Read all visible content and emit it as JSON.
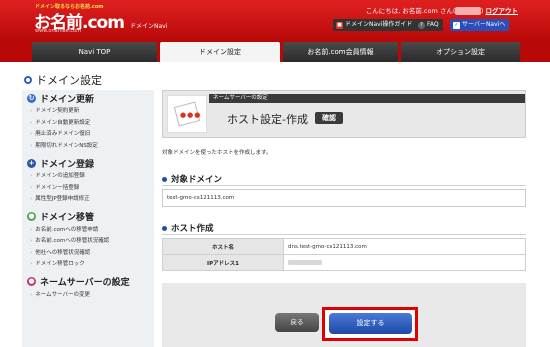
{
  "header": {
    "tagline": "ドメイン取るならお名前.com",
    "logo": "お名前.com",
    "logo_url": "www.onamae.com",
    "logo_sub": "ドメインNavi",
    "welcome_prefix": "こんにちは, お名前.com さん(",
    "welcome_masked": "******",
    "welcome_suffix": ") ",
    "logout": "ログアウト",
    "btn_guide": "ドメインNavi操作ガイド",
    "btn_faq": "FAQ",
    "btn_server": "サーバーNaviへ"
  },
  "tabs": {
    "t1": "Navi TOP",
    "t2": "ドメイン設定",
    "t3": "お名前.com会員情報",
    "t4": "オプション設定"
  },
  "page_title": "ドメイン設定",
  "sidebar": {
    "update": {
      "title": "ドメイン更新",
      "items": [
        "ドメイン契約更新",
        "ドメイン自動更新設定",
        "廃止済みドメイン復旧",
        "期限切れドメインNS設定"
      ]
    },
    "register": {
      "title": "ドメイン登録",
      "items": [
        "ドメインの追加登録",
        "ドメイン一括登録",
        "属性型JP登録申請修正"
      ]
    },
    "transfer": {
      "title": "ドメイン移管",
      "items": [
        "お名前.comへの移管申請",
        "お名前.comへの移管状況確認",
        "他社への移管状況確認",
        "ドメイン移管ロック"
      ]
    },
    "ns": {
      "title": "ネームサーバーの設定",
      "items": [
        "ネームサーバーの変更"
      ]
    }
  },
  "step": {
    "bar": "ネームサーバーの設定",
    "title": "ホスト設定-作成",
    "badge": "確認"
  },
  "description": "対象ドメインを使ったホストを作成します。",
  "target_domain": {
    "heading": "対象ドメイン",
    "value": "test-gmo-cs121113.com"
  },
  "host_create": {
    "heading": "ホスト作成",
    "rows": [
      {
        "label": "ホスト名",
        "value": "dns.test-gmo-cs121113.com"
      },
      {
        "label": "IPアドレス1",
        "value": ""
      }
    ]
  },
  "buttons": {
    "back": "戻る",
    "submit": "設定する"
  },
  "colors": {
    "brand_red": "#c80a0a",
    "tab_dark": "#333333",
    "accent_blue": "#1c4aa6",
    "highlight": "#e00000"
  }
}
